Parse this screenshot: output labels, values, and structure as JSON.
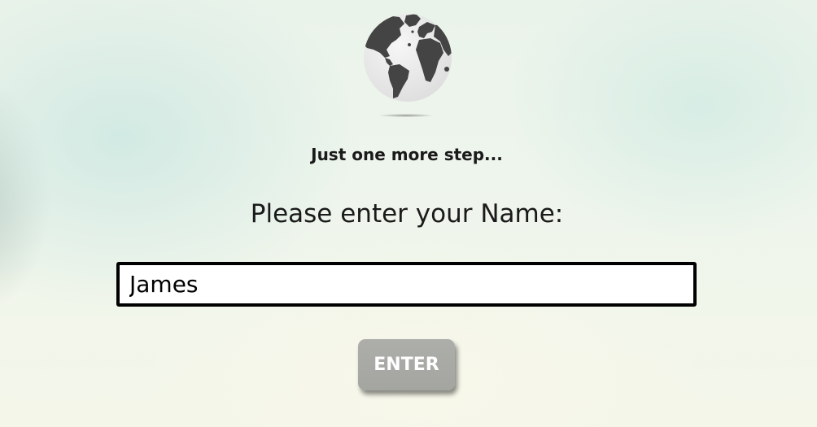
{
  "logo": {
    "icon": "globe-icon"
  },
  "heading": {
    "step_text": "Just one more step..."
  },
  "form": {
    "prompt": "Please enter your Name:",
    "name_value": "James",
    "submit_label": "ENTER"
  },
  "colors": {
    "text": "#1a1a1a",
    "button_bg": "#a8a9a4",
    "button_text": "#ffffff",
    "input_border": "#000000",
    "globe_land": "#444444",
    "globe_water": "#ececec"
  }
}
